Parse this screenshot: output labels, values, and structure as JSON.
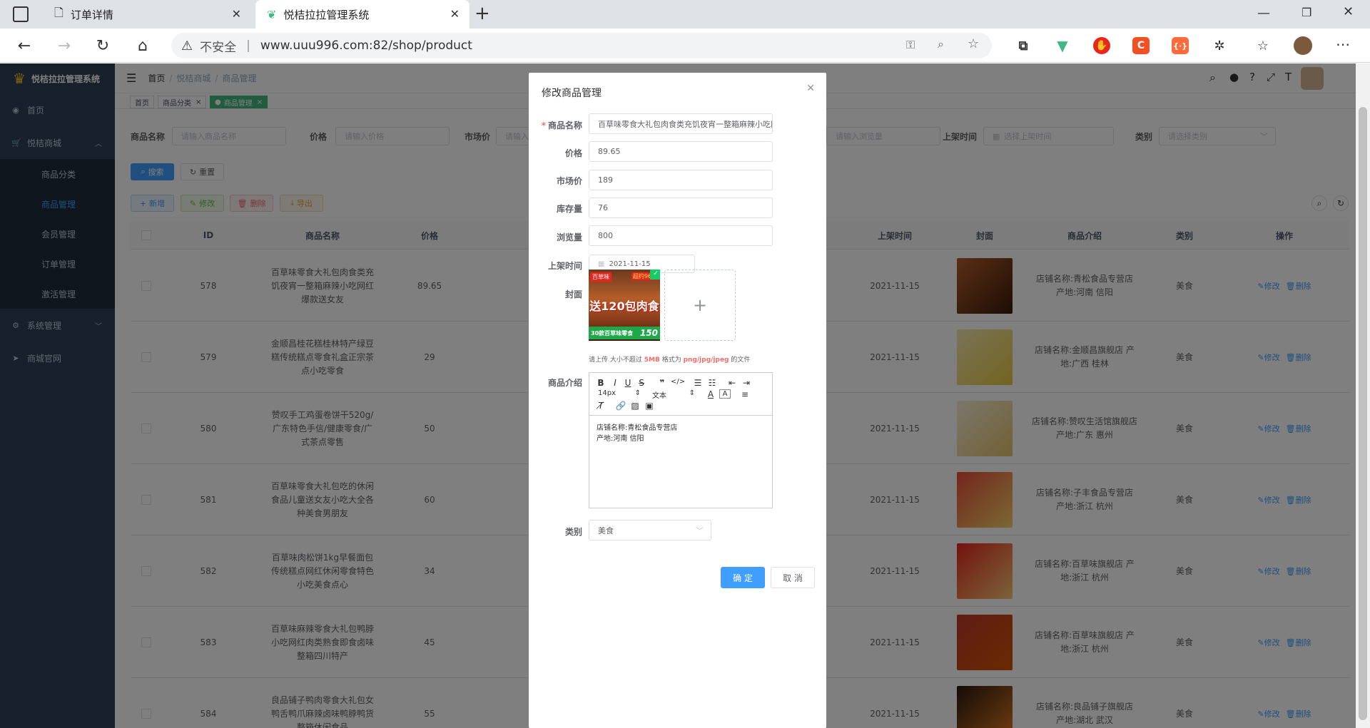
{
  "browser": {
    "tabs": [
      {
        "title": "订单详情"
      },
      {
        "title": "悦桔拉拉管理系统"
      }
    ],
    "security": "不安全",
    "url": "www.uuu996.com:82/shop/product"
  },
  "app": {
    "logo": "悦桔拉拉管理系统",
    "menu": {
      "home": "首页",
      "mall": "悦桔商城",
      "sub": [
        "商品分类",
        "商品管理",
        "会员管理",
        "订单管理",
        "激活管理"
      ],
      "system": "系统管理",
      "site": "商城官网"
    },
    "breadcrumb": [
      "首页",
      "悦桔商城",
      "商品管理"
    ],
    "tags": [
      "首页",
      "商品分类",
      "商品管理"
    ],
    "filters": [
      {
        "label": "商品名称",
        "placeholder": "请输入商品名称"
      },
      {
        "label": "价格",
        "placeholder": "请输入价格"
      },
      {
        "label": "市场价",
        "placeholder": "请输入"
      },
      {
        "label": "",
        "placeholder": "请输入浏览量"
      },
      {
        "label": "上架时间",
        "placeholder": "选择上架时间"
      },
      {
        "label": "类别",
        "placeholder": "请选择类别"
      }
    ],
    "buttons": {
      "search": "搜索",
      "reset": "重置",
      "add": "新增",
      "edit": "修改",
      "delete": "删除",
      "export": "导出"
    },
    "columns": [
      "ID",
      "商品名称",
      "价格",
      "上架时间",
      "封面",
      "商品介绍",
      "类别",
      "操作"
    ],
    "rows": [
      {
        "id": "578",
        "name": "百草味零食大礼包肉食类充饥夜宵一整箱麻辣小吃网红爆款送女友",
        "price": "89.65",
        "date": "2021-11-15",
        "intro": "店铺名称:青松食品专营店 产地:河南 信阳",
        "cat": "美食"
      },
      {
        "id": "579",
        "name": "金顺昌桂花糕桂林特产绿豆糕传统糕点零食礼盒正宗茶点小吃零食",
        "price": "29",
        "date": "2021-11-15",
        "intro": "店铺名称:金顺昌旗舰店 产地:广西 桂林",
        "cat": "美食"
      },
      {
        "id": "580",
        "name": "赞叹手工鸡蛋卷饼干520g/广东特色手信/健康零食/广式茶点零售",
        "price": "50",
        "date": "2021-11-15",
        "intro": "店铺名称:赞叹生活馆旗舰店 产地:广东 惠州",
        "cat": "美食"
      },
      {
        "id": "581",
        "name": "百草味零食大礼包吃的休闲食品儿童送女友小吃大全各种美食男朋友",
        "price": "60",
        "date": "2021-11-15",
        "intro": "店铺名称:子丰食品专营店 产地:浙江 杭州",
        "cat": "美食"
      },
      {
        "id": "582",
        "name": "百草味肉松饼1kg早餐面包传统糕点网红休闲零食特色小吃美食点心",
        "price": "34",
        "date": "2021-11-15",
        "intro": "店铺名称:百草味旗舰店 产地:浙江 杭州",
        "cat": "美食"
      },
      {
        "id": "583",
        "name": "百草味麻辣零食大礼包鸭脖小吃网红肉类熟食即食卤味整箱四川特产",
        "price": "45",
        "date": "2021-11-15",
        "intro": "店铺名称:百草味旗舰店 产地:浙江 杭州",
        "cat": "美食"
      },
      {
        "id": "584",
        "name": "良品铺子鸭肉零食大礼包女鸭舌鸭爪麻辣卤味鸭脖鸭货整箱休闲食品",
        "price": "55",
        "date": "2021-11-15",
        "intro": "店铺名称:良品铺子旗舰店 产地:湖北 武汉",
        "cat": "美食"
      }
    ],
    "row_ops": {
      "edit": "修改",
      "delete": "删除"
    }
  },
  "dialog": {
    "title": "修改商品管理",
    "fields": {
      "name_label": "商品名称",
      "name_value": "百草味零食大礼包肉食类充饥夜宵一整箱麻辣小吃网红爆款送女友",
      "price_label": "价格",
      "price_value": "89.65",
      "market_label": "市场价",
      "market_value": "189",
      "stock_label": "库存量",
      "stock_value": "76",
      "views_label": "浏览量",
      "views_value": "800",
      "date_label": "上架时间",
      "date_value": "2021-11-15",
      "cover_label": "封面",
      "intro_label": "商品介绍",
      "cat_label": "类别",
      "cat_value": "美食"
    },
    "cover_image": {
      "badge": "百草味",
      "top_tag": "超约96斤",
      "headline": "送120包肉食",
      "bottom": "30款百草味零食",
      "price": "150"
    },
    "upload_plus": "+",
    "upload_tip": {
      "a": "请上传 大小不超过",
      "b": "5MB",
      "c": "格式为",
      "d": "png/jpg/jpeg",
      "e": "的文件"
    },
    "editor": {
      "font_size": "14px",
      "font_type": "文本",
      "content_line1": "店铺名称:青松食品专营店",
      "content_line2": "产地:河南 信阳"
    },
    "ok": "确 定",
    "cancel": "取 消"
  },
  "colors": {
    "primary": "#409eff",
    "sidebar": "#304156",
    "success": "#67c23a",
    "danger": "#f56c6c",
    "warning": "#e6a23c"
  }
}
